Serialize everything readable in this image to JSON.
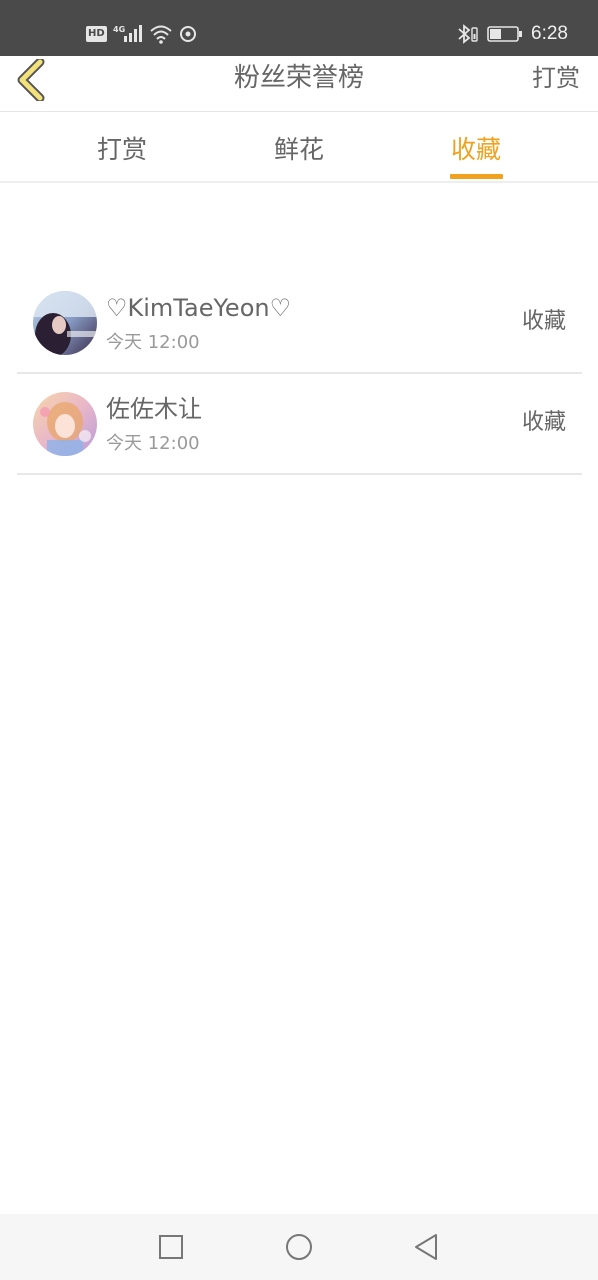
{
  "status_bar": {
    "hd": "HD",
    "network": "4G",
    "time": "6:28"
  },
  "header": {
    "title": "粉丝荣誉榜",
    "right_action": "打赏",
    "back_icon": "chevron-left-icon"
  },
  "tabs": [
    {
      "label": "打赏",
      "active": false
    },
    {
      "label": "鲜花",
      "active": false
    },
    {
      "label": "收藏",
      "active": true
    }
  ],
  "list": {
    "items": [
      {
        "name": "♡KimTaeYeon♡",
        "time": "今天 12:00",
        "action": "收藏"
      },
      {
        "name": "佐佐木让",
        "time": "今天 12:00",
        "action": "收藏"
      }
    ]
  },
  "colors": {
    "accent": "#f0a21e",
    "status_bar": "#4a4a4a",
    "back_arrow": "#f3e27a",
    "text": "#666666"
  }
}
